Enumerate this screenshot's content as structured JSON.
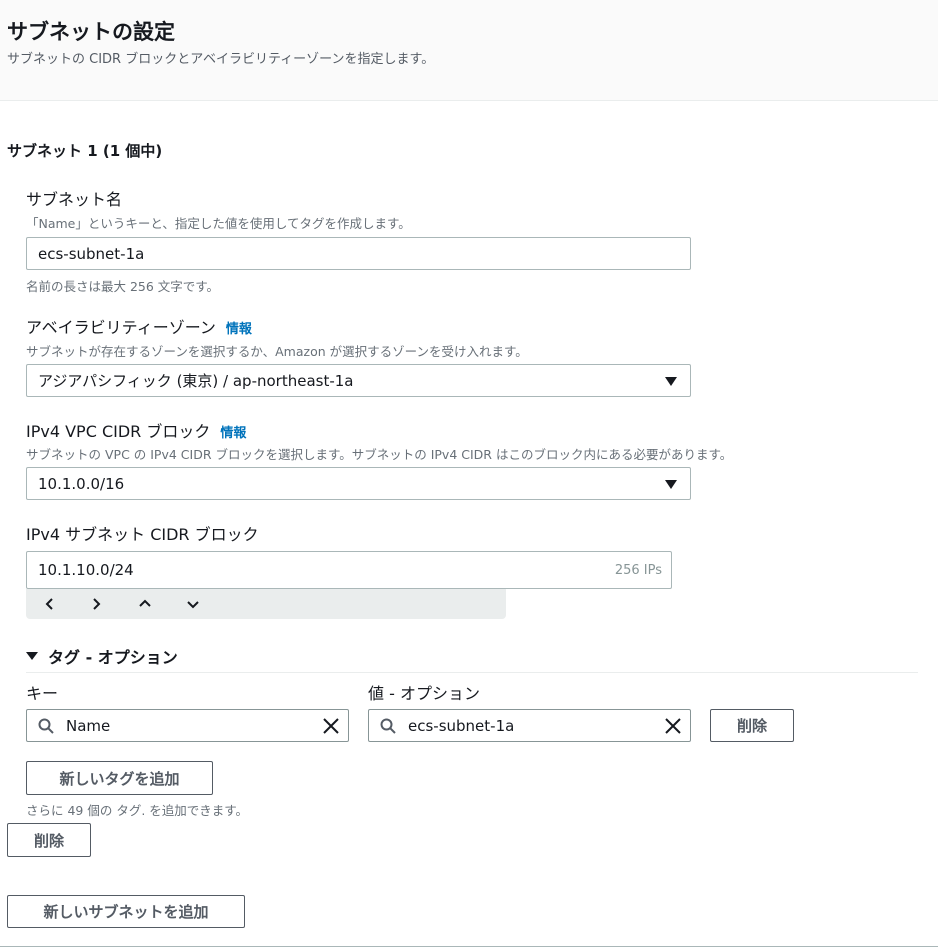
{
  "header": {
    "title": "サブネットの設定",
    "description": "サブネットの CIDR ブロックとアベイラビリティーゾーンを指定します。"
  },
  "subnet": {
    "title": "サブネット 1 (1 個中)",
    "name": {
      "label": "サブネット名",
      "description": "「Name」というキーと、指定した値を使用してタグを作成します。",
      "value": "ecs-subnet-1a",
      "hint": "名前の長さは最大 256 文字です。"
    },
    "az": {
      "label": "アベイラビリティーゾーン",
      "info": "情報",
      "description": "サブネットが存在するゾーンを選択するか、Amazon が選択するゾーンを受け入れます。",
      "value": "アジアパシフィック (東京) / ap-northeast-1a"
    },
    "vpc_cidr": {
      "label": "IPv4 VPC CIDR ブロック",
      "info": "情報",
      "description": "サブネットの VPC の IPv4 CIDR ブロックを選択します。サブネットの IPv4 CIDR はこのブロック内にある必要があります。",
      "value": "10.1.0.0/16"
    },
    "subnet_cidr": {
      "label": "IPv4 サブネット CIDR ブロック",
      "value": "10.1.10.0/24",
      "ips": "256 IPs"
    },
    "stepper": {
      "left": "‹",
      "right": "›",
      "up": "⌃",
      "down": "⌄"
    },
    "tags": {
      "toggle_label": "タグ - オプション",
      "key_label": "キー",
      "value_label": "値 - オプション",
      "key_value": "Name",
      "value_value": "ecs-subnet-1a",
      "remove_tag_label": "削除",
      "add_tag_label": "新しいタグを追加",
      "limit_text": "さらに 49 個の タグ. を追加できます。"
    },
    "remove_subnet_label": "削除"
  },
  "add_subnet_label": "新しいサブネットを追加",
  "colors": {
    "info_link": "#0073bb",
    "border": "#aab7b8",
    "button_text": "#545b64"
  }
}
